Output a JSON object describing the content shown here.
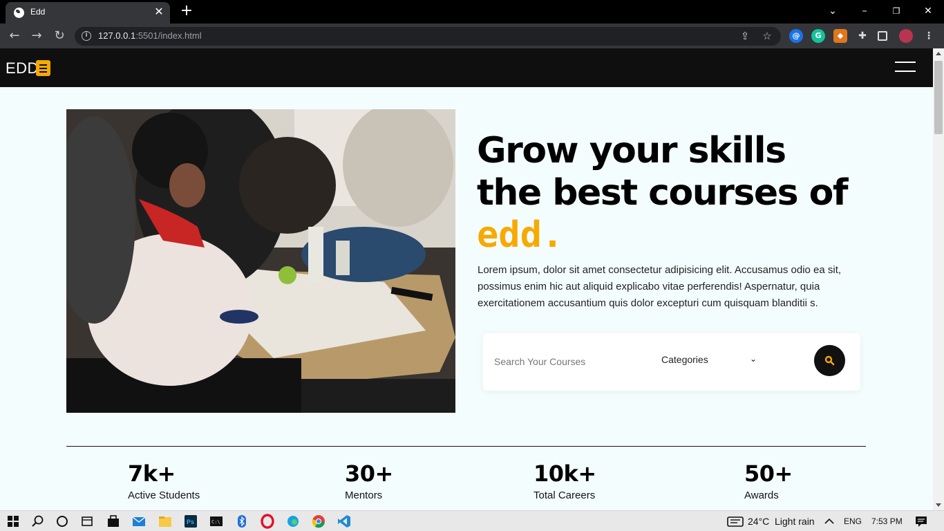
{
  "browser": {
    "tab_title": "Edd",
    "url_host": "127.0.0.1",
    "url_rest": ":5501/index.html"
  },
  "site": {
    "logo": "EDD",
    "headline_line1": "Grow your skills",
    "headline_line2": "the best courses of",
    "headline_accent": "edd.",
    "lead": "Lorem ipsum, dolor sit amet consectetur adipisicing elit. Accusamus odio ea sit, possimus enim hic aut aliquid explicabo vitae perferendis! Aspernatur, quia exercitationem accusantium quis dolor excepturi cum quisquam blanditii s.",
    "search_placeholder": "Search Your Courses",
    "category_label": "Categories",
    "stats": [
      {
        "value": "7k+",
        "label": "Active Students"
      },
      {
        "value": "30+",
        "label": "Mentors"
      },
      {
        "value": "10k+",
        "label": "Total Careers"
      },
      {
        "value": "50+",
        "label": "Awards"
      }
    ],
    "accent_color": "#f7a904"
  },
  "taskbar": {
    "weather": "24°C",
    "weather_text": "Light rain",
    "lang": "ENG",
    "time": "7:53 PM"
  }
}
